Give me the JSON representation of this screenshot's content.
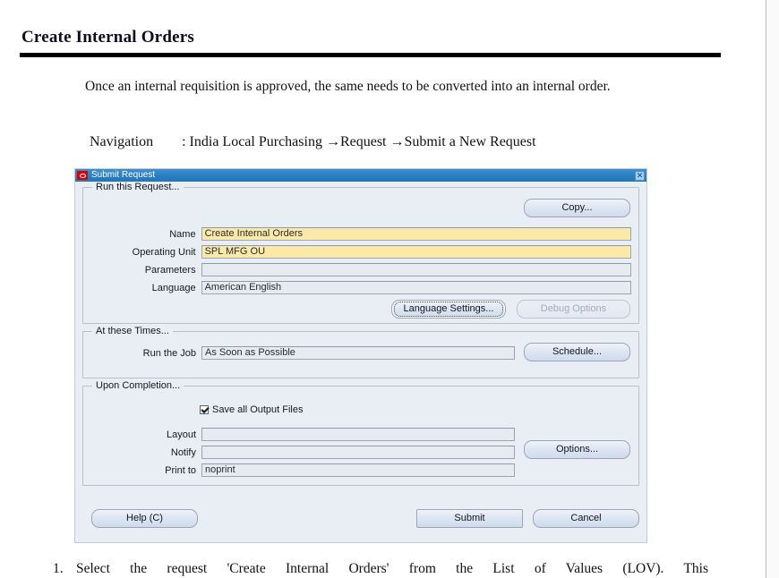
{
  "document": {
    "heading": "Create Internal Orders",
    "intro_paragraph": "Once an internal requisition is approved, the same needs to be converted into an internal order.",
    "navigation_line": "Navigation        : India Local Purchasing →Request →Submit a New Request",
    "footer_item_number": "1.",
    "footer_item_text": "Select the request 'Create Internal Orders' from the List of Values (LOV). This"
  },
  "dialog": {
    "title": "Submit Request",
    "logo_icon": "oracle-logo-icon",
    "close_icon": "close-icon",
    "close_label": "✕",
    "groups": {
      "run_this_request": {
        "title": "Run this Request...",
        "copy_button": "Copy...",
        "fields": [
          {
            "label": "Name",
            "value": "Create Internal Orders",
            "required": true
          },
          {
            "label": "Operating Unit",
            "value": "SPL MFG OU",
            "required": true
          },
          {
            "label": "Parameters",
            "value": "",
            "required": false
          },
          {
            "label": "Language",
            "value": "American English",
            "required": false
          }
        ],
        "language_settings_button": "Language Settings...",
        "language_settings_mnemonic": "a",
        "debug_options_button": "Debug Options",
        "debug_options_mnemonic": "b",
        "debug_options_enabled": false
      },
      "at_these_times": {
        "title": "At these Times...",
        "field": {
          "label": "Run the Job",
          "value": "As Soon as Possible"
        },
        "schedule_button": "Schedule...",
        "schedule_mnemonic": "d"
      },
      "upon_completion": {
        "title": "Upon Completion...",
        "checkbox": {
          "label": "Save all Output Files",
          "mnemonic": "S",
          "checked": true
        },
        "fields": [
          {
            "label": "Layout",
            "value": ""
          },
          {
            "label": "Notify",
            "value": ""
          },
          {
            "label": "Print to",
            "value": "noprint"
          }
        ],
        "options_button": "Options...",
        "options_mnemonic": "p"
      }
    },
    "footer_buttons": {
      "help": "Help (C)",
      "submit": "Submit",
      "submit_mnemonic": "m",
      "cancel": "Cancel",
      "cancel_mnemonic": "n"
    }
  },
  "colors": {
    "titlebar_blue": "#2a7ec2",
    "oracle_red": "#d90000",
    "required_field_yellow": "#fbe9a8",
    "dialog_background": "#e9edf4",
    "heading_text": "#0d0d1e"
  }
}
